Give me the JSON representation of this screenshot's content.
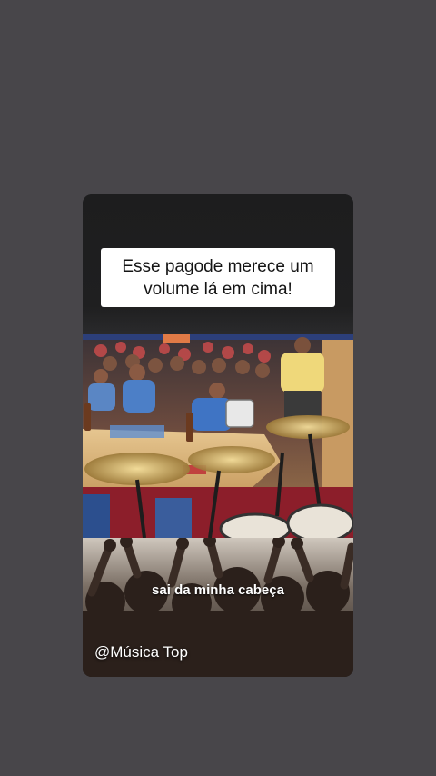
{
  "story": {
    "caption": "Esse pagode merece um volume lá em cima!",
    "lyric": "sai da minha cabeça",
    "handle": "@Música Top"
  },
  "colors": {
    "background": "#48464a",
    "card": "#1b1b1c",
    "caption_box": "#ffffff",
    "caption_text": "#141414",
    "overlay_text": "#ffffff"
  }
}
